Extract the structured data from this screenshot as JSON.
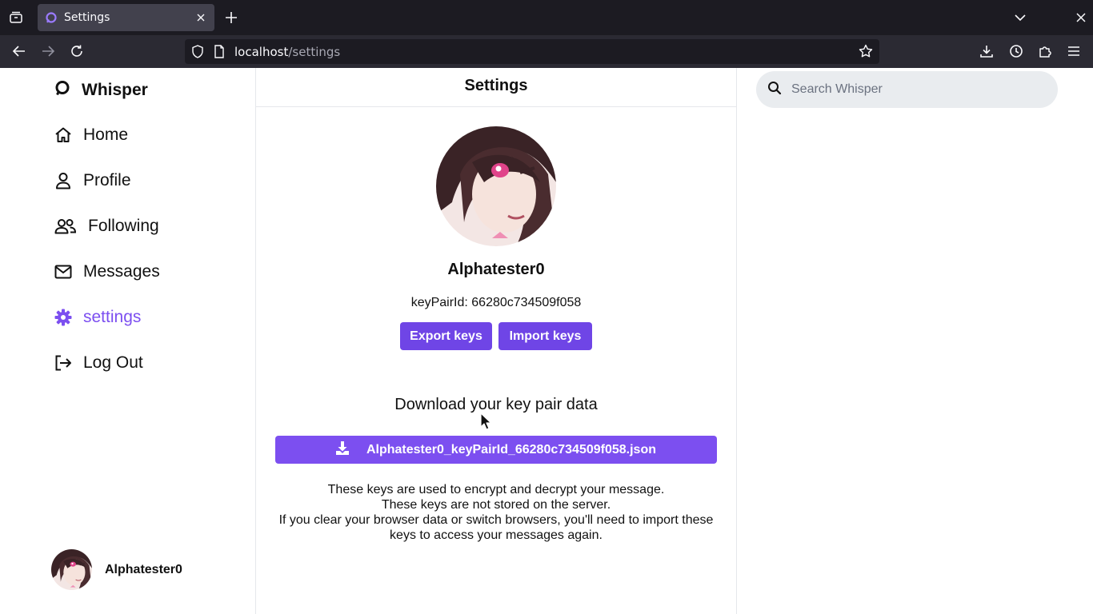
{
  "browser": {
    "tab_title": "Settings",
    "url_host": "localhost",
    "url_path": "/settings"
  },
  "sidebar": {
    "brand": "Whisper",
    "items": [
      {
        "label": "Home",
        "icon": "home-icon"
      },
      {
        "label": "Profile",
        "icon": "user-icon"
      },
      {
        "label": "Following",
        "icon": "users-icon"
      },
      {
        "label": "Messages",
        "icon": "mail-icon"
      },
      {
        "label": "settings",
        "icon": "gear-icon",
        "active": true
      },
      {
        "label": "Log Out",
        "icon": "logout-icon"
      }
    ],
    "user_name": "Alphatester0"
  },
  "main": {
    "title": "Settings",
    "display_name": "Alphatester0",
    "keypair_text": "keyPairId: 66280c734509f058",
    "export_label": "Export keys",
    "import_label": "Import keys",
    "download_title": "Download your key pair data",
    "download_file": "Alphatester0_keyPairId_66280c734509f058.json",
    "notes": [
      "These keys are used to encrypt and decrypt your message.",
      "These keys are not stored on the server.",
      "If you clear your browser data or switch browsers, you'll need to import these keys to access your messages again."
    ]
  },
  "search": {
    "placeholder": "Search Whisper"
  },
  "colors": {
    "accent": "#7c4ff0",
    "button": "#6f45e6",
    "tabbar": "#1c1b22",
    "navbar": "#2b2a33"
  }
}
